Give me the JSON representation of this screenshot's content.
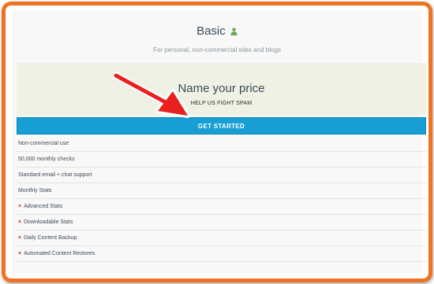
{
  "plan": {
    "title": "Basic",
    "description": "For personal, non-commercial sites and blogs"
  },
  "pricing": {
    "title": "Name your price",
    "subtitle": "HELP US FIGHT SPAM"
  },
  "cta": {
    "label": "GET STARTED"
  },
  "features": [
    {
      "label": "Non-commercial use",
      "included": true
    },
    {
      "label": "50,000 monthly checks",
      "included": true
    },
    {
      "label": "Standard email + chat support",
      "included": true
    },
    {
      "label": "Monthly Stats",
      "included": true
    },
    {
      "label": "Advanced Stats",
      "included": false,
      "marker": "×"
    },
    {
      "label": "Downloadable Stats",
      "included": false,
      "marker": "×"
    },
    {
      "label": "Daily Content Backup",
      "included": false,
      "marker": "×"
    },
    {
      "label": "Automated Content Restores",
      "included": false,
      "marker": "×"
    }
  ],
  "colors": {
    "frame_border": "#f07323",
    "cta_background": "#179fd4",
    "price_band": "#eef1e4",
    "user_icon": "#6aa84f",
    "arrow": "#e8201f",
    "excluded_marker": "#c0392b"
  },
  "icons": {
    "plan_title_icon": "user-icon",
    "annotation": "red-arrow-annotation"
  }
}
